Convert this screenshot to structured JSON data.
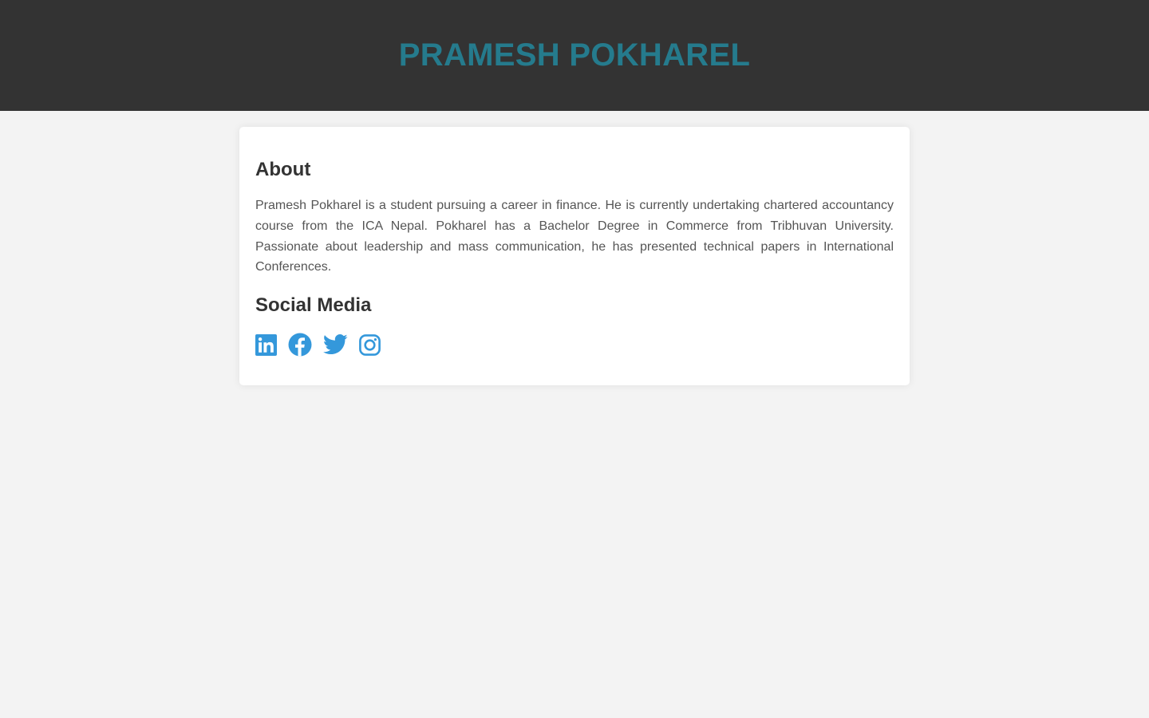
{
  "header": {
    "title": "PRAMESH POKHAREL",
    "title_color": "#257b8d",
    "background": "#333333"
  },
  "about": {
    "heading": "About",
    "text": "Pramesh Pokharel is a student pursuing a career in finance. He is currently undertaking chartered accountancy course from the ICA Nepal. Pokharel has a Bachelor Degree in Commerce from Tribhuvan University. Passionate about leadership and mass communication, he has presented technical papers in International Conferences."
  },
  "social": {
    "heading": "Social Media",
    "icon_color": "#3498db",
    "links": [
      {
        "icon": "linkedin-icon"
      },
      {
        "icon": "facebook-icon"
      },
      {
        "icon": "twitter-icon"
      },
      {
        "icon": "instagram-icon"
      }
    ]
  }
}
